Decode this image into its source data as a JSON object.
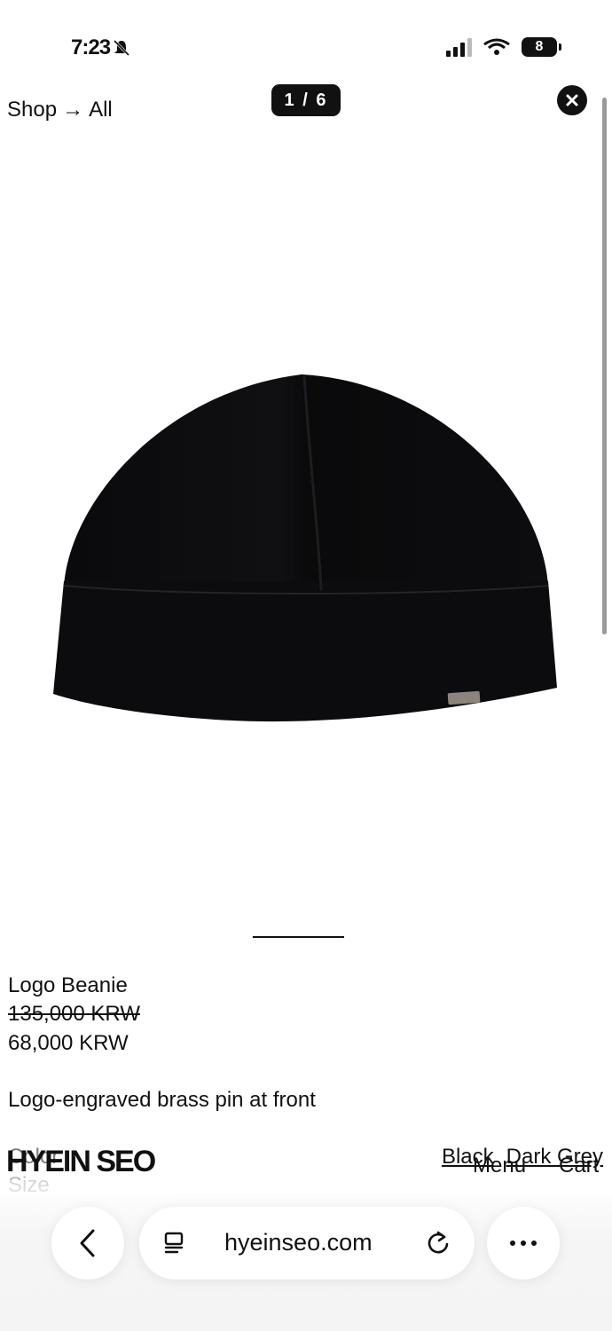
{
  "status_bar": {
    "time": "7:23"
  },
  "header": {
    "breadcrumb_shop": "Shop",
    "breadcrumb_arrow": "→",
    "breadcrumb_all": "All",
    "image_counter": "1 / 6"
  },
  "product": {
    "name": "Logo Beanie",
    "price_original": "135,000 KRW",
    "price_sale": "68,000 KRW",
    "description": "Logo-engraved brass pin at front",
    "color_label": "Color",
    "size_label": "Size",
    "colors": [
      "Black",
      "Dark Grey"
    ],
    "pin_text": "HYEIN SEO"
  },
  "site_nav": {
    "brand": "HYEIN SEO",
    "menu": "Menu",
    "cart": "Cart"
  },
  "browser": {
    "url": "hyeinseo.com"
  },
  "colors": {
    "text": "#111111",
    "background": "#ffffff",
    "beanie": "#0d0d0f"
  }
}
